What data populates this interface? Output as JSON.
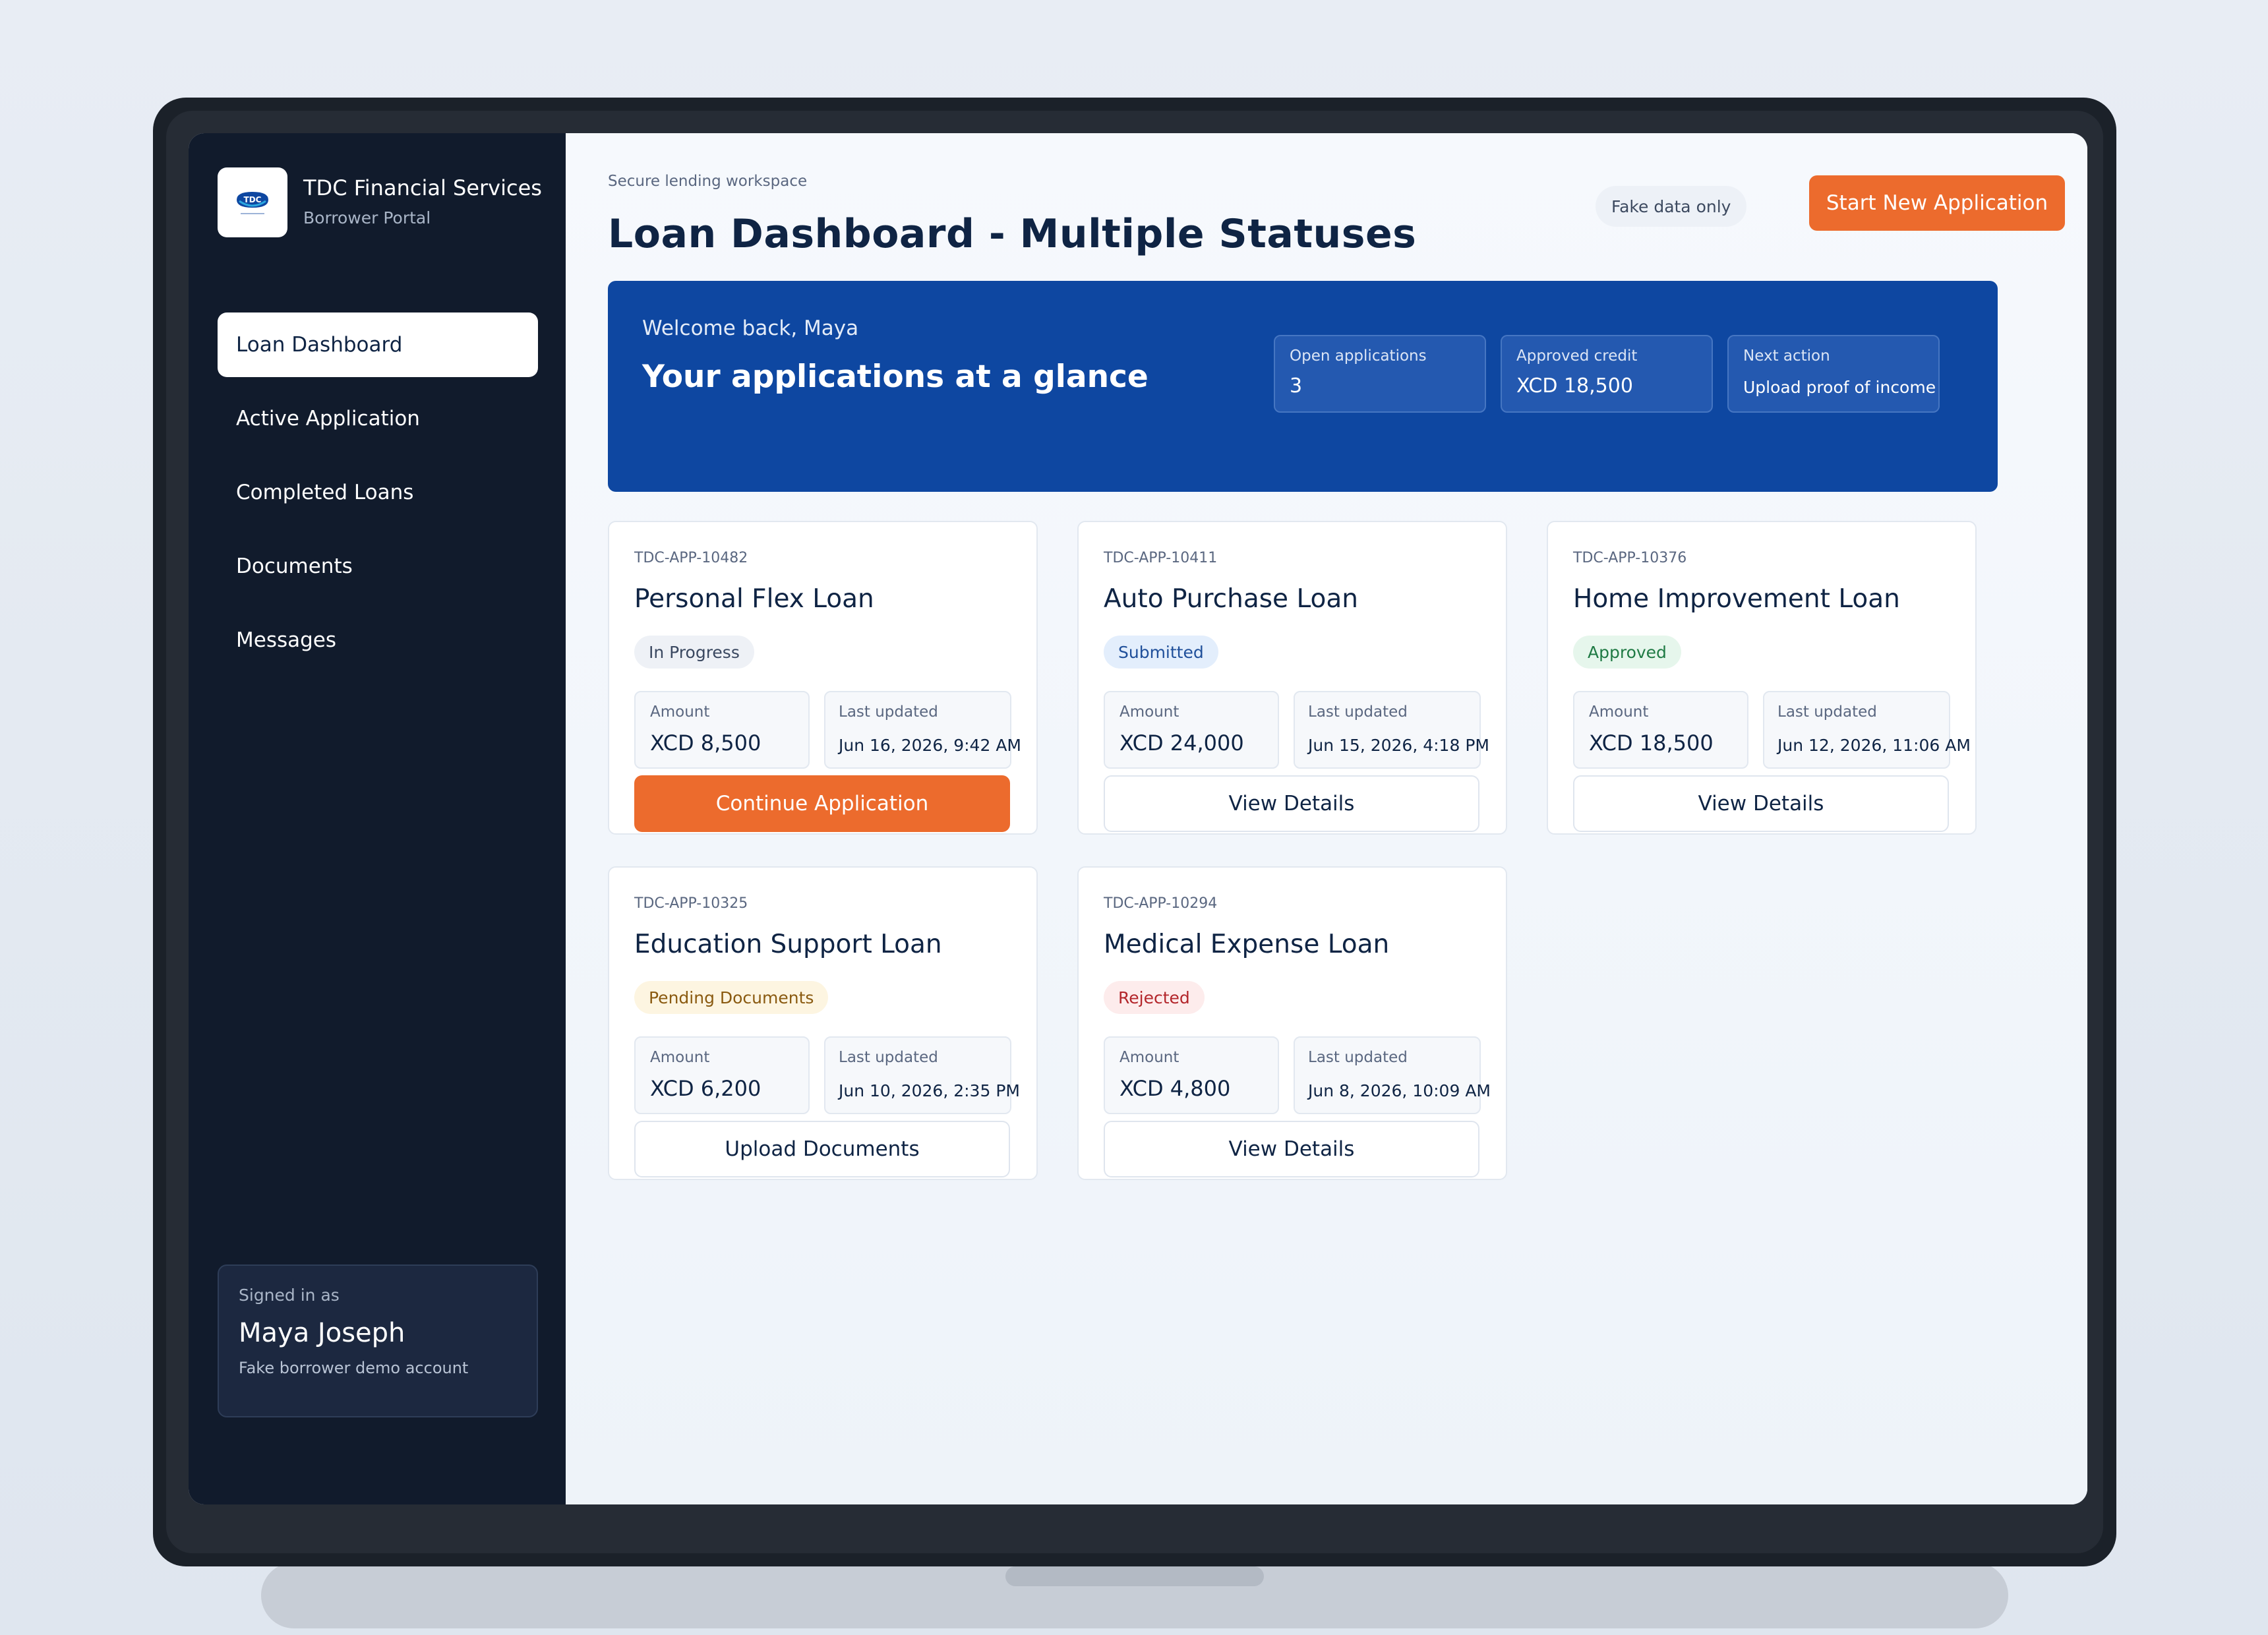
{
  "brand": {
    "name": "TDC Financial Services",
    "subtitle": "Borrower Portal",
    "logo_text": "TDC"
  },
  "nav": {
    "items": [
      {
        "label": "Loan Dashboard",
        "active": true
      },
      {
        "label": "Active Application"
      },
      {
        "label": "Completed Loans"
      },
      {
        "label": "Documents"
      },
      {
        "label": "Messages"
      }
    ]
  },
  "user": {
    "caption": "Signed in as",
    "name": "Maya Joseph",
    "note": "Fake borrower demo account"
  },
  "header": {
    "eyebrow": "Secure lending workspace",
    "title": "Loan Dashboard - Multiple Statuses",
    "badge": "Fake data only",
    "primary_action": "Start New Application"
  },
  "hero": {
    "welcome": "Welcome back, Maya",
    "title": "Your applications at a glance",
    "stats": [
      {
        "label": "Open applications",
        "value": "3"
      },
      {
        "label": "Approved credit",
        "value": "XCD 18,500"
      },
      {
        "label": "Next action",
        "value": "Upload proof of income"
      }
    ]
  },
  "labels": {
    "amount": "Amount",
    "last_updated": "Last updated"
  },
  "applications": [
    {
      "id": "TDC-APP-10482",
      "title": "Personal Flex Loan",
      "status": "In Progress",
      "amount": "XCD 8,500",
      "updated": "Jun 16, 2026, 9:42 AM",
      "action": "Continue Application"
    },
    {
      "id": "TDC-APP-10411",
      "title": "Auto Purchase Loan",
      "status": "Submitted",
      "amount": "XCD 24,000",
      "updated": "Jun 15, 2026, 4:18 PM",
      "action": "View Details"
    },
    {
      "id": "TDC-APP-10376",
      "title": "Home Improvement Loan",
      "status": "Approved",
      "amount": "XCD 18,500",
      "updated": "Jun 12, 2026, 11:06 AM",
      "action": "View Details"
    },
    {
      "id": "TDC-APP-10325",
      "title": "Education Support Loan",
      "status": "Pending Documents",
      "amount": "XCD 6,200",
      "updated": "Jun 10, 2026, 2:35 PM",
      "action": "Upload Documents"
    },
    {
      "id": "TDC-APP-10294",
      "title": "Medical Expense Loan",
      "status": "Rejected",
      "amount": "XCD 4,800",
      "updated": "Jun 8, 2026, 10:09 AM",
      "action": "View Details"
    }
  ],
  "colors": {
    "accent": "#ec6b2d",
    "hero": "#0e47a1",
    "sidebar": "#111b2c",
    "status_in_progress": "#3a4860",
    "status_submitted": "#1f4f9a",
    "status_approved": "#1f7a44",
    "status_pending": "#8a5a10",
    "status_rejected": "#b3262b"
  }
}
